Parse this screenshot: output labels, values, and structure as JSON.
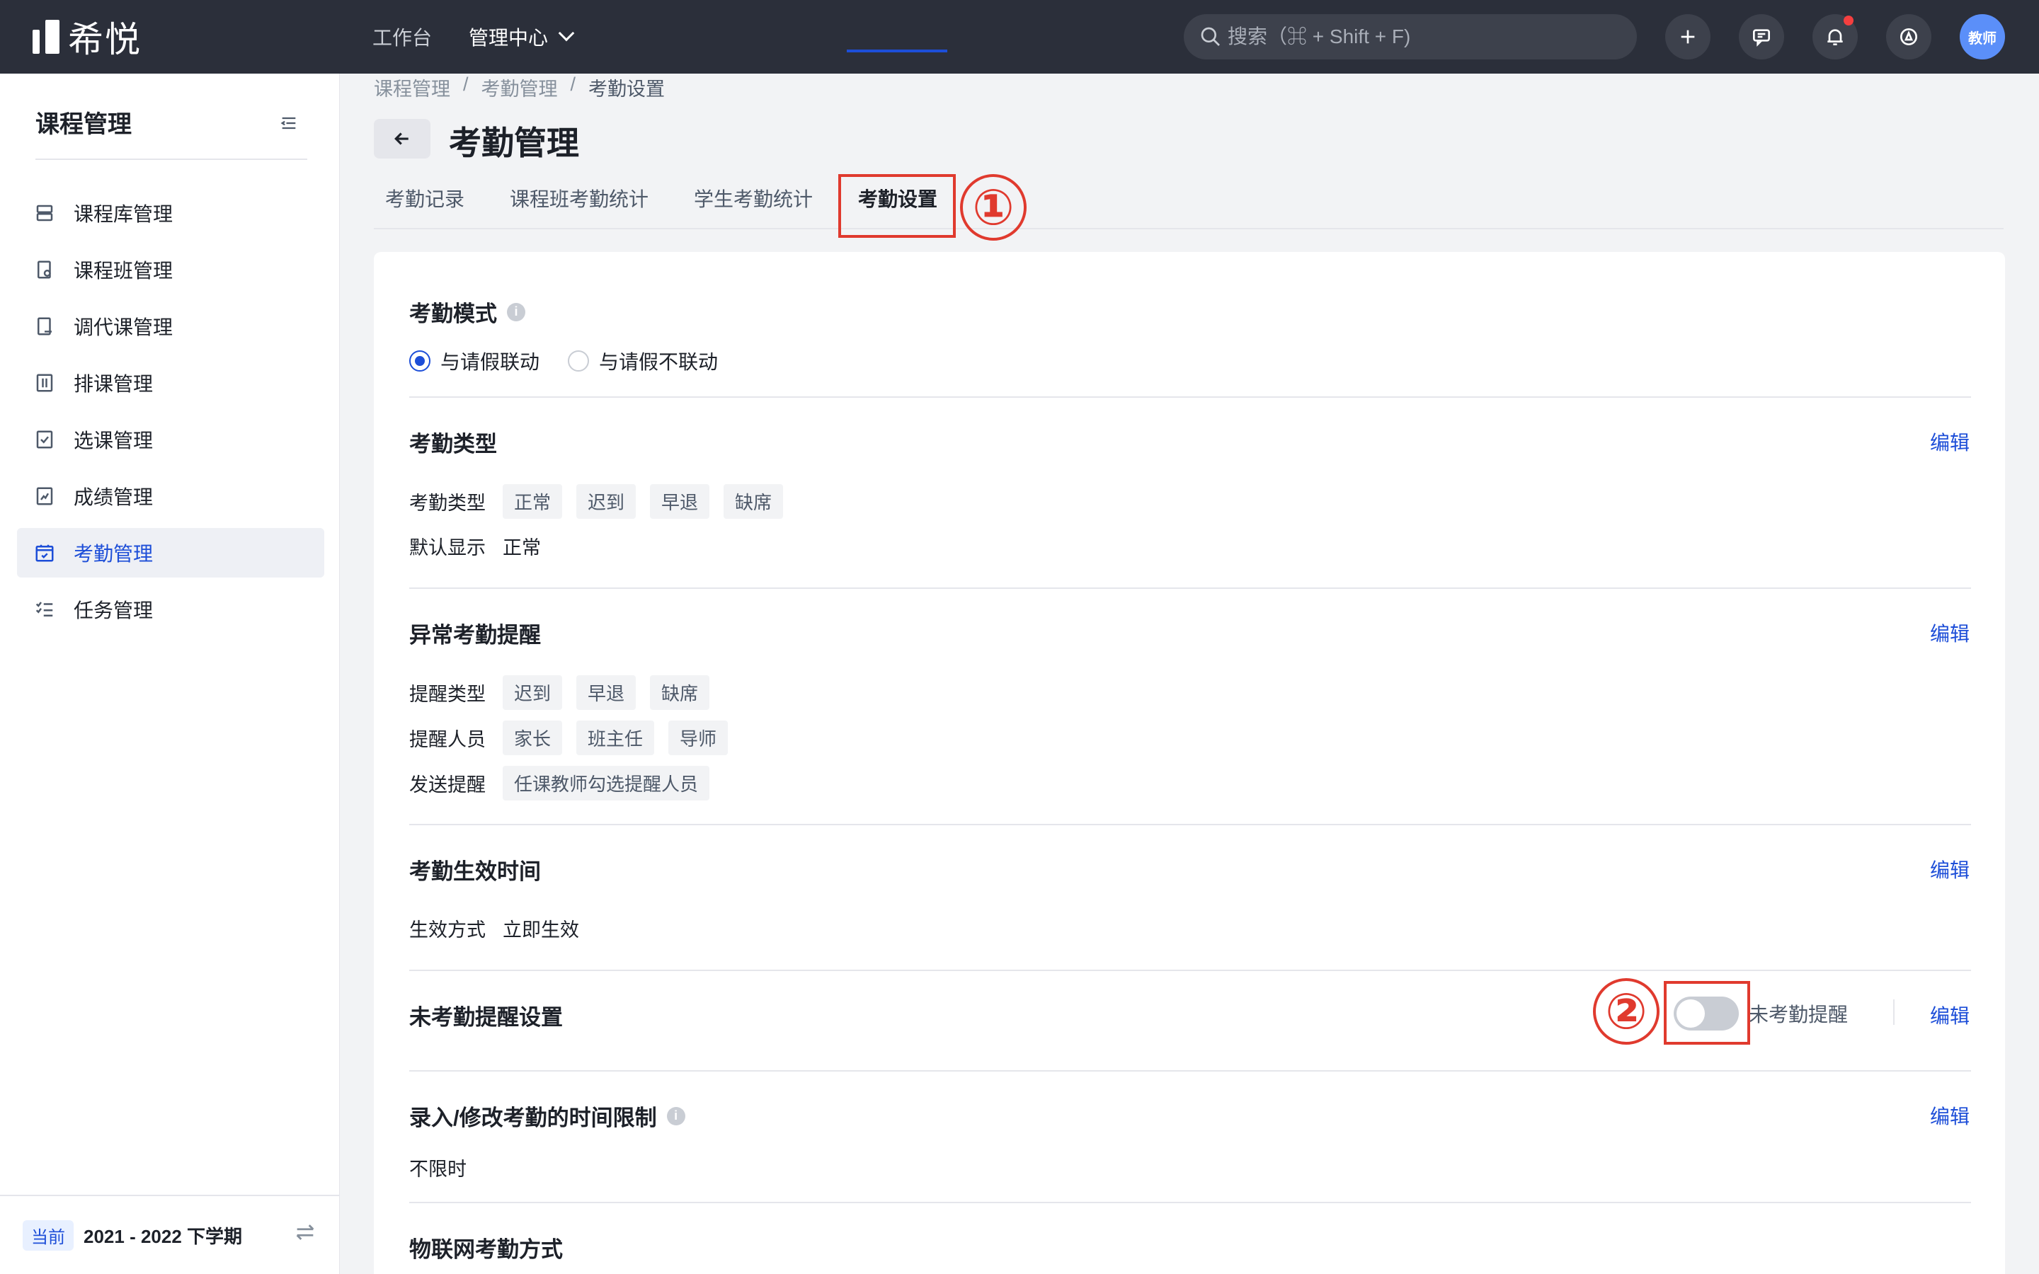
{
  "topbar": {
    "logo_text": "希悦",
    "nav": [
      {
        "label": "工作台"
      },
      {
        "label": "管理中心"
      }
    ],
    "search_placeholder": "搜索（⌘ + Shift + F)",
    "avatar_text": "教师"
  },
  "sidebar": {
    "title": "课程管理",
    "items": [
      {
        "label": "课程库管理"
      },
      {
        "label": "课程班管理"
      },
      {
        "label": "调代课管理"
      },
      {
        "label": "排课管理"
      },
      {
        "label": "选课管理"
      },
      {
        "label": "成绩管理"
      },
      {
        "label": "考勤管理",
        "active": true
      },
      {
        "label": "任务管理"
      }
    ],
    "term_badge": "当前",
    "term_text": "2021 - 2022 下学期"
  },
  "breadcrumb": [
    "课程管理",
    "/",
    "考勤管理",
    "/",
    "考勤设置"
  ],
  "page_title": "考勤管理",
  "tabs": [
    {
      "label": "考勤记录"
    },
    {
      "label": "课程班考勤统计"
    },
    {
      "label": "学生考勤统计"
    },
    {
      "label": "考勤设置",
      "active": true
    }
  ],
  "annotations": {
    "one": "①",
    "two": "②",
    "color": "#e03a2e"
  },
  "sections": {
    "mode": {
      "title": "考勤模式",
      "options": [
        {
          "label": "与请假联动",
          "checked": true
        },
        {
          "label": "与请假不联动",
          "checked": false
        }
      ]
    },
    "type": {
      "title": "考勤类型",
      "edit": "编辑",
      "row1_label": "考勤类型",
      "tags": [
        "正常",
        "迟到",
        "早退",
        "缺席"
      ],
      "row2_label": "默认显示",
      "row2_value": "正常"
    },
    "abnormal": {
      "title": "异常考勤提醒",
      "edit": "编辑",
      "row1_label": "提醒类型",
      "row1_tags": [
        "迟到",
        "早退",
        "缺席"
      ],
      "row2_label": "提醒人员",
      "row2_tags": [
        "家长",
        "班主任",
        "导师"
      ],
      "row3_label": "发送提醒",
      "row3_tags": [
        "任课教师勾选提醒人员"
      ]
    },
    "effective": {
      "title": "考勤生效时间",
      "edit": "编辑",
      "row_label": "生效方式",
      "row_value": "立即生效"
    },
    "reminder": {
      "title": "未考勤提醒设置",
      "switch_on": false,
      "switch_label": "未考勤提醒",
      "edit": "编辑"
    },
    "limit": {
      "title": "录入/修改考勤的时间限制",
      "edit": "编辑",
      "value": "不限时"
    },
    "iot": {
      "title": "物联网考勤方式"
    }
  },
  "colors": {
    "accent": "#1d4ed8",
    "topbar": "#2b2f3a",
    "annotation": "#e03a2e"
  }
}
